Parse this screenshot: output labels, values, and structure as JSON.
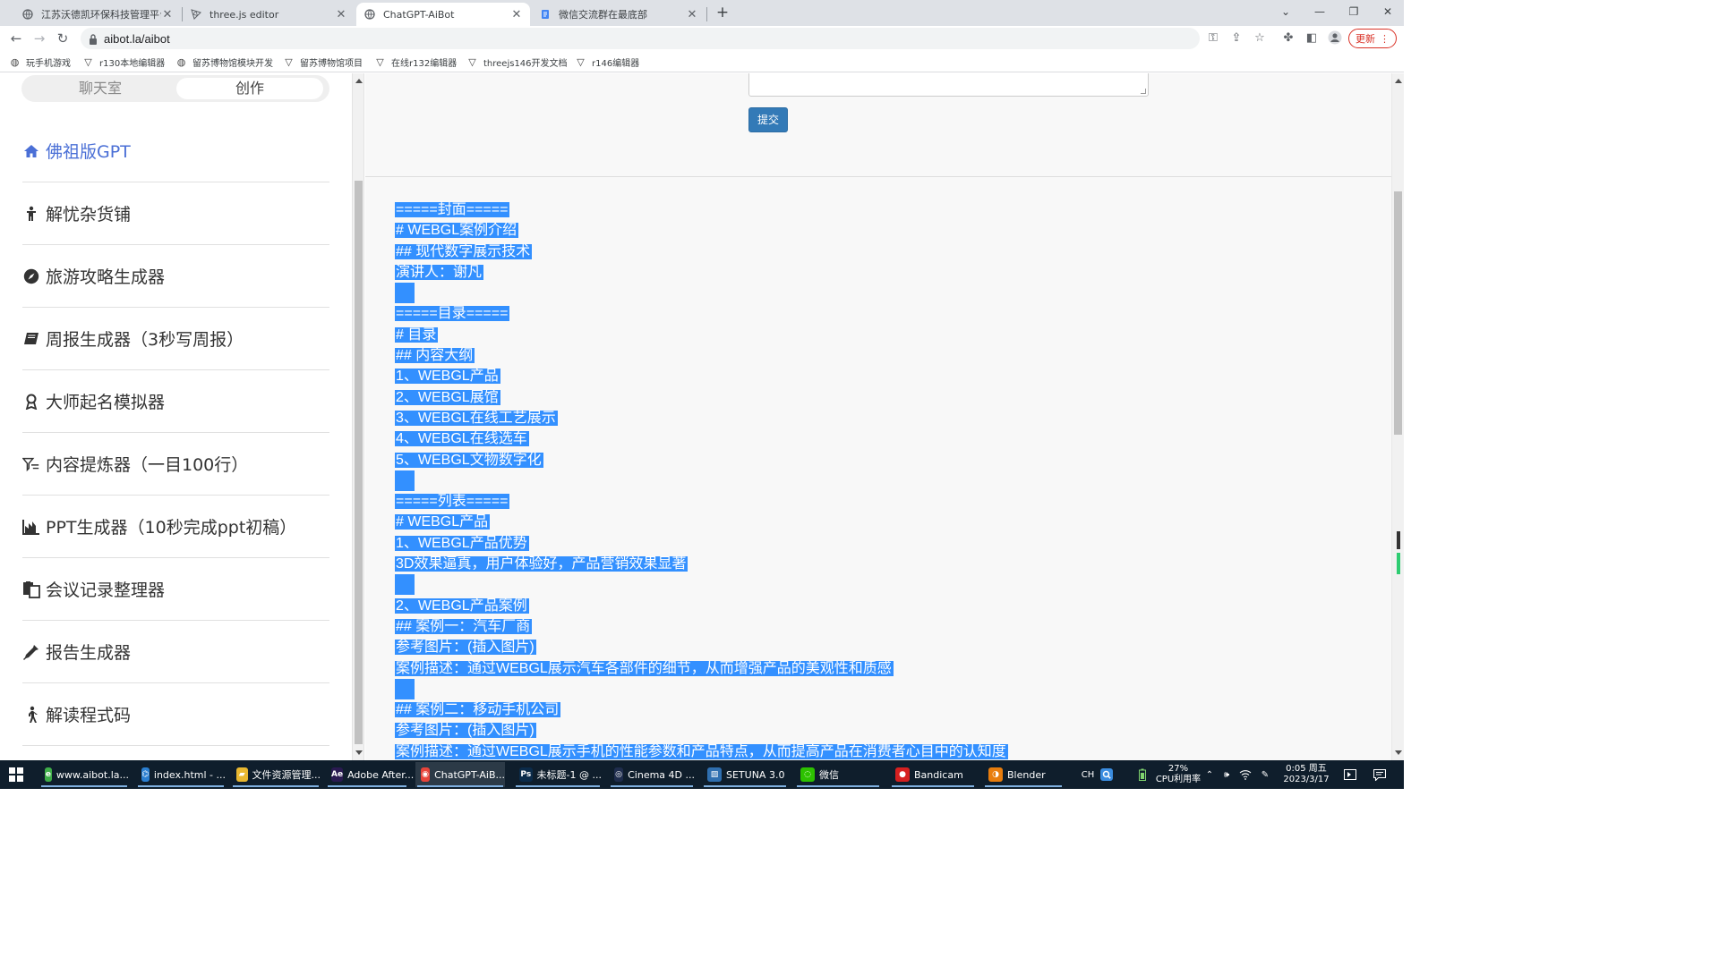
{
  "browser": {
    "tabs": [
      {
        "title": "江苏沃德凯环保科技管理平台系统",
        "active": false
      },
      {
        "title": "three.js editor",
        "active": false
      },
      {
        "title": "ChatGPT-AiBot",
        "active": true
      },
      {
        "title": "微信交流群在最底部",
        "active": false
      }
    ],
    "new_tab": "+",
    "url": "aibot.la/aibot",
    "update_label": "更新",
    "bookmarks": [
      "玩手机游戏",
      "r130本地编辑器",
      "留苏博物馆模块开发",
      "留苏博物馆项目",
      "在线r132编辑器",
      "threejs146开发文档",
      "r146编辑器"
    ]
  },
  "sidebar": {
    "segments": [
      "聊天室",
      "创作"
    ],
    "items": [
      {
        "label": "佛祖版GPT",
        "icon": "home-icon"
      },
      {
        "label": "解忧杂货铺",
        "icon": "person-icon"
      },
      {
        "label": "旅游攻略生成器",
        "icon": "compass-icon"
      },
      {
        "label": "周报生成器（3秒写周报）",
        "icon": "book-icon"
      },
      {
        "label": "大师起名模拟器",
        "icon": "award-icon"
      },
      {
        "label": "内容提炼器（一目100行）",
        "icon": "filter-icon"
      },
      {
        "label": "PPT生成器（10秒完成ppt初稿）",
        "icon": "chart-icon"
      },
      {
        "label": "会议记录整理器",
        "icon": "clipboard-icon"
      },
      {
        "label": "报告生成器",
        "icon": "eyedropper-icon"
      },
      {
        "label": "解读程式码",
        "icon": "walking-icon"
      }
    ]
  },
  "main": {
    "submit_label": "提交",
    "output_lines": [
      "=====封面=====",
      "# WEBGL案例介绍",
      "## 现代数字展示技术",
      "演讲人：谢凡",
      "",
      "=====目录=====",
      "# 目录",
      "## 内容大纲",
      "1、WEBGL产品",
      "2、WEBGL展馆",
      "3、WEBGL在线工艺展示",
      "4、WEBGL在线选车",
      "5、WEBGL文物数字化",
      "",
      "=====列表=====",
      "# WEBGL产品",
      "1、WEBGL产品优势",
      "3D效果逼真，用户体验好，产品营销效果显著",
      "",
      "2、WEBGL产品案例",
      "## 案例一：汽车厂商",
      "参考图片：(插入图片)",
      "案例描述：通过WEBGL展示汽车各部件的细节，从而增强产品的美观性和质感",
      "",
      "## 案例二：移动手机公司",
      "参考图片：(插入图片)",
      "案例描述：通过WEBGL展示手机的性能参数和产品特点，从而提高产品在消费者心目中的认知度"
    ]
  },
  "taskbar": {
    "tasks": [
      {
        "label": "www.aibot.la...",
        "icon": "chrome-alt-icon",
        "color": "#3fae49"
      },
      {
        "label": "index.html - ...",
        "icon": "vscode-icon",
        "color": "#2b7fd1"
      },
      {
        "label": "文件资源管理...",
        "icon": "folder-icon",
        "color": "#e8b730"
      },
      {
        "label": "Adobe After...",
        "icon": "after-effects-icon",
        "color": "#2a1a52"
      },
      {
        "label": "ChatGPT-AiB...",
        "icon": "chrome-icon",
        "color": "#e8443a"
      },
      {
        "label": "未标题-1 @ ...",
        "icon": "photoshop-icon",
        "color": "#0b2b4a"
      },
      {
        "label": "Cinema 4D ...",
        "icon": "cinema4d-icon",
        "color": "#1f2d4d"
      },
      {
        "label": "SETUNA 3.0",
        "icon": "setuna-icon",
        "color": "#2f6fb0"
      },
      {
        "label": "微信",
        "icon": "wechat-icon",
        "color": "#2dc100"
      },
      {
        "label": "Bandicam",
        "icon": "bandicam-icon",
        "color": "#d62020"
      },
      {
        "label": "Blender",
        "icon": "blender-icon",
        "color": "#e87d0d"
      }
    ],
    "ime": "CH",
    "cpu_percent": "27%",
    "cpu_label": "CPU利用率",
    "time": "0:05 周五",
    "date": "2023/3/17"
  },
  "colors": {
    "selection": "#3390ff",
    "accent": "#4a6fd6",
    "submit": "#337ab7",
    "taskbar": "#0f1e2c"
  }
}
